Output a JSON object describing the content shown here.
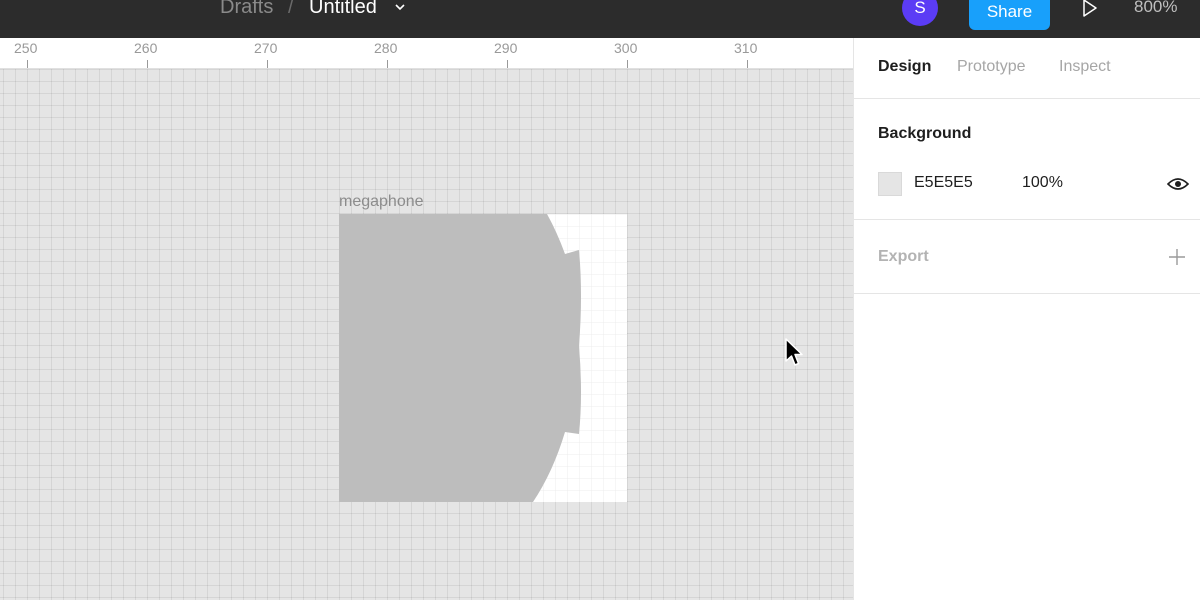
{
  "topbar": {
    "breadcrumb_parent": "Drafts",
    "breadcrumb_separator": "/",
    "file_name": "Untitled",
    "avatar_initial": "S",
    "share_label": "Share",
    "zoom_level": "800%",
    "icons": [
      "chevron-down-icon",
      "play-icon"
    ]
  },
  "ruler": {
    "labels": [
      "250",
      "260",
      "270",
      "280",
      "290",
      "300",
      "310"
    ]
  },
  "canvas": {
    "background_color": "#E5E5E5",
    "frame_label": "megaphone",
    "shape_color": "#BDBDBD"
  },
  "panel": {
    "tabs": [
      {
        "label": "Design",
        "active": true
      },
      {
        "label": "Prototype",
        "active": false
      },
      {
        "label": "Inspect",
        "active": false
      }
    ],
    "background": {
      "title": "Background",
      "hex": "E5E5E5",
      "opacity": "100%",
      "icon": "eye-icon"
    },
    "export": {
      "title": "Export",
      "icon": "plus-icon"
    }
  },
  "colors": {
    "topbar": "#2C2C2C",
    "accent": "#18A0FB",
    "avatar": "#5B3CF5"
  }
}
